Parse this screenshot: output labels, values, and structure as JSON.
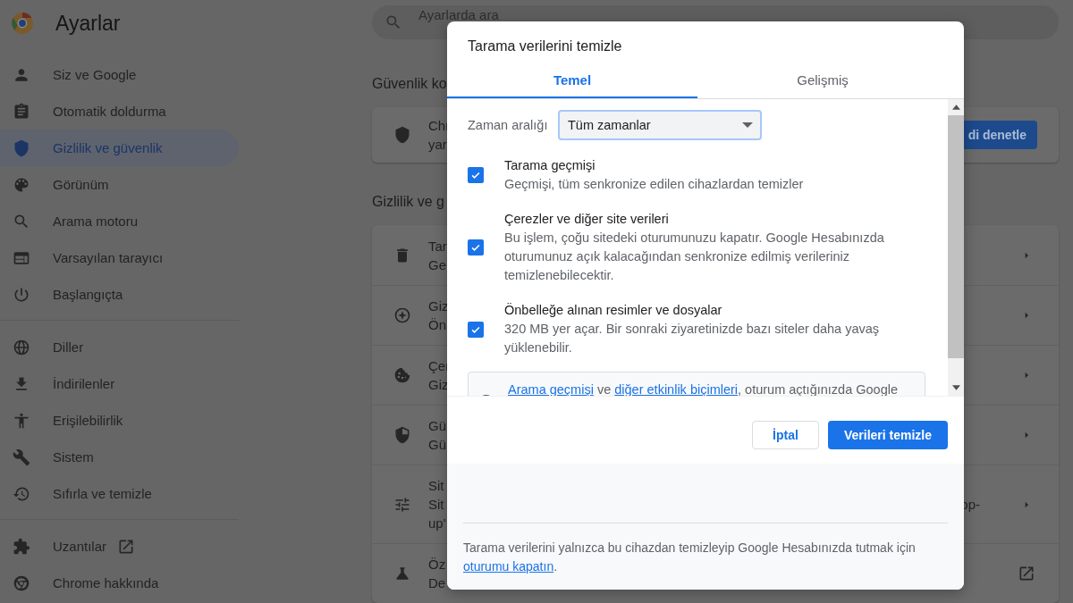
{
  "sidebar": {
    "title": "Ayarlar",
    "groups": [
      {
        "items": [
          {
            "label": "Siz ve Google",
            "selected": false,
            "external": false
          },
          {
            "label": "Otomatik doldurma",
            "selected": false,
            "external": false
          },
          {
            "label": "Gizlilik ve güvenlik",
            "selected": true,
            "external": false
          },
          {
            "label": "Görünüm",
            "selected": false,
            "external": false
          },
          {
            "label": "Arama motoru",
            "selected": false,
            "external": false
          },
          {
            "label": "Varsayılan tarayıcı",
            "selected": false,
            "external": false
          },
          {
            "label": "Başlangıçta",
            "selected": false,
            "external": false
          }
        ]
      },
      {
        "items": [
          {
            "label": "Diller",
            "selected": false,
            "external": false
          },
          {
            "label": "İndirilenler",
            "selected": false,
            "external": false
          },
          {
            "label": "Erişilebilirlik",
            "selected": false,
            "external": false
          },
          {
            "label": "Sistem",
            "selected": false,
            "external": false
          },
          {
            "label": "Sıfırla ve temizle",
            "selected": false,
            "external": false
          }
        ]
      },
      {
        "items": [
          {
            "label": "Uzantılar",
            "selected": false,
            "external": true
          },
          {
            "label": "Chrome hakkında",
            "selected": false,
            "external": false
          }
        ]
      }
    ]
  },
  "main": {
    "search": {
      "placeholder": "Ayarlarda ara"
    },
    "safety": {
      "title": "Güvenlik ko",
      "lines": [
        "Chr",
        "yar"
      ],
      "button": "di denetle"
    },
    "privacy": {
      "title": "Gizlilik ve g",
      "rows": [
        {
          "lines": [
            "Tar",
            "Ge"
          ],
          "external": false
        },
        {
          "lines": [
            "Giz",
            "Ön"
          ],
          "external": false
        },
        {
          "lines": [
            "Çer",
            "Giz"
          ],
          "external": false
        },
        {
          "lines": [
            "Gü",
            "Gü"
          ],
          "external": false
        },
        {
          "lines": [
            "Sit",
            "Sit",
            "up'"
          ],
          "right_text": "op-",
          "external": false
        },
        {
          "lines": [
            "Öz",
            "De"
          ],
          "external": true
        }
      ]
    }
  },
  "dialog": {
    "title": "Tarama verilerini temizle",
    "tabs": [
      {
        "label": "Temel",
        "selected": true
      },
      {
        "label": "Gelişmiş",
        "selected": false
      }
    ],
    "time_range": {
      "label": "Zaman aralığı",
      "value": "Tüm zamanlar"
    },
    "options": [
      {
        "title": "Tarama geçmişi",
        "description": "Geçmişi, tüm senkronize edilen cihazlardan temizler",
        "checked": true
      },
      {
        "title": "Çerezler ve diğer site verileri",
        "description": "Bu işlem, çoğu sitedeki oturumunuzu kapatır. Google Hesabınızda oturumunuz açık kalacağından senkronize edilmiş verileriniz temizlenebilecektir.",
        "checked": true
      },
      {
        "title": "Önbelleğe alınan resimler ve dosyalar",
        "description": "320 MB yer açar. Bir sonraki ziyaretinizde bazı siteler daha yavaş yüklenebilir.",
        "checked": true
      }
    ],
    "info": [
      {
        "text": "Arama geçmişi",
        "link": true
      },
      {
        "text": " ve ",
        "link": false
      },
      {
        "text": "diğer etkinlik biçimleri",
        "link": true
      },
      {
        "text": ", oturum açtığınızda Google",
        "link": false
      }
    ],
    "buttons": [
      {
        "label": "İptal",
        "kind": "secondary"
      },
      {
        "label": "Verileri temizle",
        "kind": "primary"
      }
    ],
    "footer": [
      {
        "text": "Tarama verilerini yalnızca bu cihazdan temizleyip Google Hesabınızda tutmak için ",
        "link": false
      },
      {
        "text": "oturumu kapatın",
        "link": true
      },
      {
        "text": ".",
        "link": false
      }
    ]
  }
}
